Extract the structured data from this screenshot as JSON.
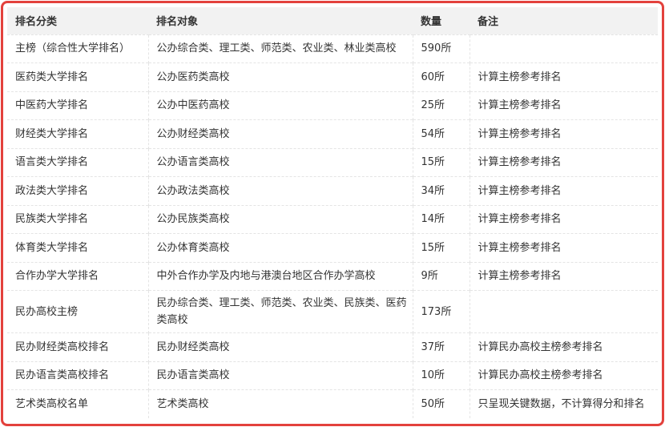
{
  "headers": [
    "排名分类",
    "排名对象",
    "数量",
    "备注"
  ],
  "rows": [
    {
      "category": "主榜（综合性大学排名）",
      "target": "公办综合类、理工类、师范类、农业类、林业类高校",
      "count": "590所",
      "note": ""
    },
    {
      "category": "医药类大学排名",
      "target": "公办医药类高校",
      "count": "60所",
      "note": "计算主榜参考排名"
    },
    {
      "category": "中医药大学排名",
      "target": "公办中医药高校",
      "count": "25所",
      "note": "计算主榜参考排名"
    },
    {
      "category": "财经类大学排名",
      "target": "公办财经类高校",
      "count": "54所",
      "note": "计算主榜参考排名"
    },
    {
      "category": "语言类大学排名",
      "target": "公办语言类高校",
      "count": "15所",
      "note": "计算主榜参考排名"
    },
    {
      "category": "政法类大学排名",
      "target": "公办政法类高校",
      "count": "34所",
      "note": "计算主榜参考排名"
    },
    {
      "category": "民族类大学排名",
      "target": "公办民族类高校",
      "count": "14所",
      "note": "计算主榜参考排名"
    },
    {
      "category": "体育类大学排名",
      "target": "公办体育类高校",
      "count": "15所",
      "note": "计算主榜参考排名"
    },
    {
      "category": "合作办学大学排名",
      "target": "中外合作办学及内地与港澳台地区合作办学高校",
      "count": "9所",
      "note": "计算主榜参考排名"
    },
    {
      "category": "民办高校主榜",
      "target": "民办综合类、理工类、师范类、农业类、民族类、医药类高校",
      "count": "173所",
      "note": ""
    },
    {
      "category": "民办财经类高校排名",
      "target": "民办财经类高校",
      "count": "37所",
      "note": "计算民办高校主榜参考排名"
    },
    {
      "category": "民办语言类高校排名",
      "target": "民办语言类高校",
      "count": "10所",
      "note": "计算民办高校主榜参考排名"
    },
    {
      "category": "艺术类高校名单",
      "target": "艺术类高校",
      "count": "50所",
      "note": "只呈现关键数据，不计算得分和排名"
    }
  ]
}
